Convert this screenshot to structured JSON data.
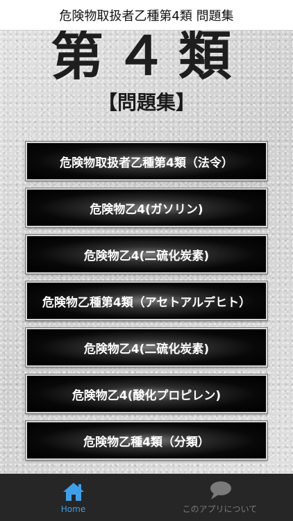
{
  "header": {
    "title": "危険物取扱者乙種第4類 問題集"
  },
  "hero": {
    "big_title": "第４類",
    "sub_title": "【問題集】"
  },
  "menu": [
    {
      "label": "危険物取扱者乙種第4類（法令）"
    },
    {
      "label": "危険物乙4(ガソリン)"
    },
    {
      "label": "危険物乙4(二硫化炭素)"
    },
    {
      "label": "危険物乙種第4類（アセトアルデヒト）"
    },
    {
      "label": "危険物乙4(二硫化炭素)"
    },
    {
      "label": "危険物乙4(酸化プロピレン)"
    },
    {
      "label": "危険物乙種4類（分類）"
    }
  ],
  "tabbar": {
    "home": {
      "label": "Home",
      "icon": "home-icon",
      "color": "#3ea0ea"
    },
    "about": {
      "label": "このアプリについて",
      "icon": "speech-bubble-icon",
      "color": "#7a7a7a"
    }
  },
  "colors": {
    "tabbar_bg": "#262626",
    "accent": "#3ea0ea"
  }
}
